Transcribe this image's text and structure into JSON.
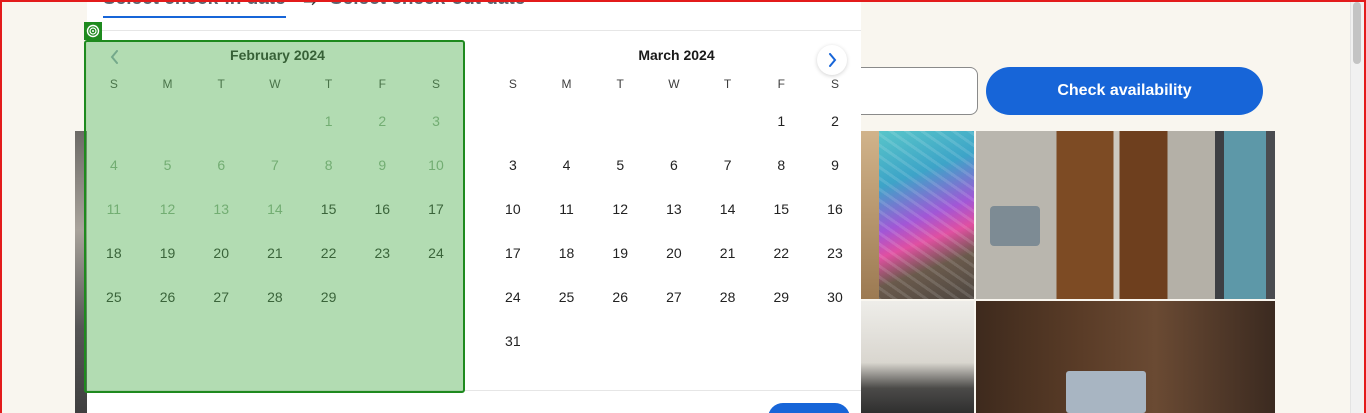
{
  "page": {
    "check_availability_label": "Check availability"
  },
  "date_picker": {
    "tab_checkin": "Select check-in date",
    "tab_checkout": "Select check-out date",
    "arrow_glyph": "→",
    "prev_glyph": "‹",
    "next_glyph": "›",
    "weekdays": [
      "S",
      "M",
      "T",
      "W",
      "T",
      "F",
      "S"
    ],
    "months": [
      {
        "title": "February 2024",
        "weeks": [
          [
            {
              "d": "",
              "s": "empty"
            },
            {
              "d": "",
              "s": "empty"
            },
            {
              "d": "",
              "s": "empty"
            },
            {
              "d": "",
              "s": "empty"
            },
            {
              "d": "1",
              "s": "disabled"
            },
            {
              "d": "2",
              "s": "disabled"
            },
            {
              "d": "3",
              "s": "disabled"
            }
          ],
          [
            {
              "d": "4",
              "s": "disabled"
            },
            {
              "d": "5",
              "s": "disabled"
            },
            {
              "d": "6",
              "s": "disabled"
            },
            {
              "d": "7",
              "s": "disabled"
            },
            {
              "d": "8",
              "s": "disabled"
            },
            {
              "d": "9",
              "s": "disabled"
            },
            {
              "d": "10",
              "s": "disabled"
            }
          ],
          [
            {
              "d": "11",
              "s": "disabled"
            },
            {
              "d": "12",
              "s": "disabled"
            },
            {
              "d": "13",
              "s": "disabled"
            },
            {
              "d": "14",
              "s": "disabled"
            },
            {
              "d": "15",
              "s": "available"
            },
            {
              "d": "16",
              "s": "available"
            },
            {
              "d": "17",
              "s": "available"
            }
          ],
          [
            {
              "d": "18",
              "s": "available"
            },
            {
              "d": "19",
              "s": "available"
            },
            {
              "d": "20",
              "s": "available"
            },
            {
              "d": "21",
              "s": "available"
            },
            {
              "d": "22",
              "s": "available"
            },
            {
              "d": "23",
              "s": "available"
            },
            {
              "d": "24",
              "s": "available"
            }
          ],
          [
            {
              "d": "25",
              "s": "available"
            },
            {
              "d": "26",
              "s": "available"
            },
            {
              "d": "27",
              "s": "available"
            },
            {
              "d": "28",
              "s": "available"
            },
            {
              "d": "29",
              "s": "available"
            },
            {
              "d": "",
              "s": "empty"
            },
            {
              "d": "",
              "s": "empty"
            }
          ]
        ]
      },
      {
        "title": "March 2024",
        "weeks": [
          [
            {
              "d": "",
              "s": "empty"
            },
            {
              "d": "",
              "s": "empty"
            },
            {
              "d": "",
              "s": "empty"
            },
            {
              "d": "",
              "s": "empty"
            },
            {
              "d": "",
              "s": "empty"
            },
            {
              "d": "1",
              "s": "available"
            },
            {
              "d": "2",
              "s": "available"
            }
          ],
          [
            {
              "d": "3",
              "s": "available"
            },
            {
              "d": "4",
              "s": "available"
            },
            {
              "d": "5",
              "s": "available"
            },
            {
              "d": "6",
              "s": "available"
            },
            {
              "d": "7",
              "s": "available"
            },
            {
              "d": "8",
              "s": "available"
            },
            {
              "d": "9",
              "s": "available"
            }
          ],
          [
            {
              "d": "10",
              "s": "available"
            },
            {
              "d": "11",
              "s": "available"
            },
            {
              "d": "12",
              "s": "available"
            },
            {
              "d": "13",
              "s": "available"
            },
            {
              "d": "14",
              "s": "available"
            },
            {
              "d": "15",
              "s": "available"
            },
            {
              "d": "16",
              "s": "available"
            }
          ],
          [
            {
              "d": "17",
              "s": "available"
            },
            {
              "d": "18",
              "s": "available"
            },
            {
              "d": "19",
              "s": "available"
            },
            {
              "d": "20",
              "s": "available"
            },
            {
              "d": "21",
              "s": "available"
            },
            {
              "d": "22",
              "s": "available"
            },
            {
              "d": "23",
              "s": "available"
            }
          ],
          [
            {
              "d": "24",
              "s": "available"
            },
            {
              "d": "25",
              "s": "available"
            },
            {
              "d": "26",
              "s": "available"
            },
            {
              "d": "27",
              "s": "available"
            },
            {
              "d": "28",
              "s": "available"
            },
            {
              "d": "29",
              "s": "available"
            },
            {
              "d": "30",
              "s": "available"
            }
          ],
          [
            {
              "d": "31",
              "s": "available"
            },
            {
              "d": "",
              "s": "empty"
            },
            {
              "d": "",
              "s": "empty"
            },
            {
              "d": "",
              "s": "empty"
            },
            {
              "d": "",
              "s": "empty"
            },
            {
              "d": "",
              "s": "empty"
            },
            {
              "d": "",
              "s": "empty"
            }
          ]
        ]
      }
    ]
  },
  "colors": {
    "accent": "#1765d8",
    "highlight_fill": "#58b258",
    "highlight_border": "#1e8a1e",
    "frame": "#e31b1b",
    "page_bg": "#f9f6ef"
  }
}
